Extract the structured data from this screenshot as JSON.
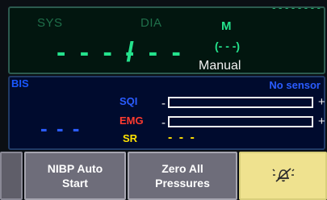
{
  "nibp": {
    "sys_label": "SYS",
    "dia_label": "DIA",
    "m_label": "M",
    "sys_value": "- - -",
    "separator": "/",
    "dia_value": "- - -",
    "m_value": "(- - -)",
    "mode": "Manual",
    "top_right_text": "- - - - - - - -"
  },
  "bis": {
    "label": "BIS",
    "sensor_status": "No sensor",
    "value": "- - -",
    "sqi_label": "SQI",
    "emg_label": "EMG",
    "sr_label": "SR",
    "minus": "-",
    "plus": "+",
    "sr_value": "- - -"
  },
  "buttons": {
    "nibp_auto_line1": "NIBP Auto",
    "nibp_auto_line2": "Start",
    "zero_all_line1": "Zero All",
    "zero_all_line2": "Pressures",
    "alarm_icon": "alarm-silence-icon"
  },
  "colors": {
    "nibp_green": "#24e28c",
    "bis_blue": "#2a5cff",
    "emg_red": "#ff3b2f",
    "sr_yellow": "#ffe300",
    "button_gray": "#6e6d7a",
    "alarm_yellow": "#efe28f"
  }
}
